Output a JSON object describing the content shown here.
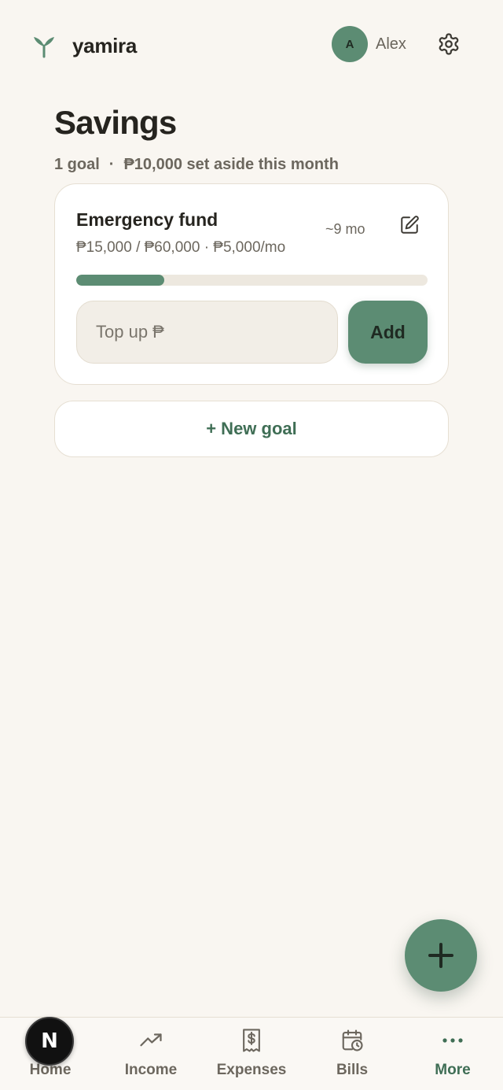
{
  "header": {
    "brand": "yamira",
    "user_initial": "A",
    "user_name": "Alex",
    "logo_icon": "sprout-icon",
    "settings_icon": "gear-icon"
  },
  "page": {
    "title": "Savings",
    "goal_count": "1 goal",
    "separator": "·",
    "set_aside": "₱10,000 set aside this month"
  },
  "goals": [
    {
      "name": "Emergency fund",
      "meta": "₱15,000 / ₱60,000 · ₱5,000/mo",
      "eta": "~9 mo",
      "progress": 0.25,
      "topup_placeholder": "Top up ₱",
      "add_label": "Add"
    }
  ],
  "new_goal_label": "+ New goal",
  "fab_icon": "plus-icon",
  "nav": {
    "items": [
      {
        "label": "Home",
        "icon": "home-icon"
      },
      {
        "label": "Income",
        "icon": "trending-up-icon"
      },
      {
        "label": "Expenses",
        "icon": "receipt-icon"
      },
      {
        "label": "Bills",
        "icon": "calendar-clock-icon"
      },
      {
        "label": "More",
        "icon": "more-dots-icon"
      }
    ],
    "badge_letter": "N"
  },
  "colors": {
    "accent": "#5c8c73",
    "accent_text": "#3f6e55",
    "background": "#f9f6f1",
    "card": "#ffffff"
  }
}
